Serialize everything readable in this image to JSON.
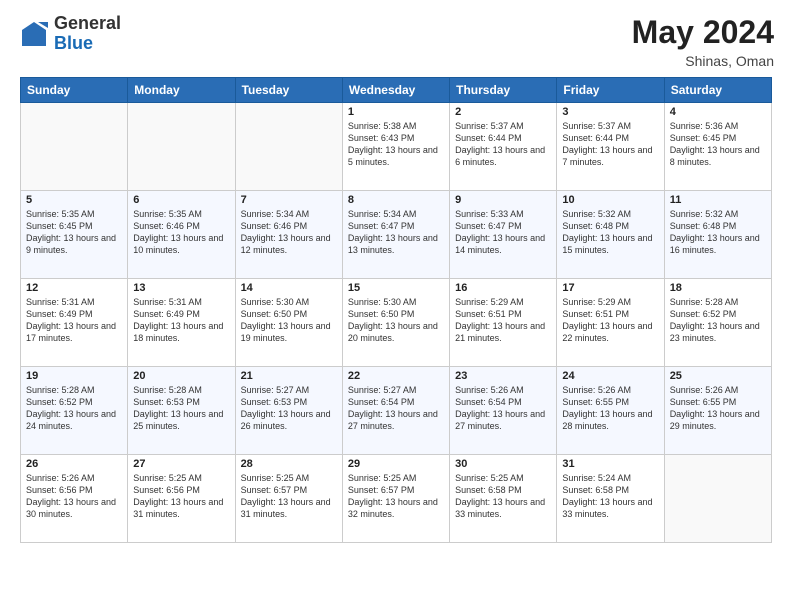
{
  "header": {
    "logo_general": "General",
    "logo_blue": "Blue",
    "month_year": "May 2024",
    "location": "Shinas, Oman"
  },
  "weekdays": [
    "Sunday",
    "Monday",
    "Tuesday",
    "Wednesday",
    "Thursday",
    "Friday",
    "Saturday"
  ],
  "weeks": [
    [
      {
        "day": "",
        "sunrise": "",
        "sunset": "",
        "daylight": ""
      },
      {
        "day": "",
        "sunrise": "",
        "sunset": "",
        "daylight": ""
      },
      {
        "day": "",
        "sunrise": "",
        "sunset": "",
        "daylight": ""
      },
      {
        "day": "1",
        "sunrise": "Sunrise: 5:38 AM",
        "sunset": "Sunset: 6:43 PM",
        "daylight": "Daylight: 13 hours and 5 minutes."
      },
      {
        "day": "2",
        "sunrise": "Sunrise: 5:37 AM",
        "sunset": "Sunset: 6:44 PM",
        "daylight": "Daylight: 13 hours and 6 minutes."
      },
      {
        "day": "3",
        "sunrise": "Sunrise: 5:37 AM",
        "sunset": "Sunset: 6:44 PM",
        "daylight": "Daylight: 13 hours and 7 minutes."
      },
      {
        "day": "4",
        "sunrise": "Sunrise: 5:36 AM",
        "sunset": "Sunset: 6:45 PM",
        "daylight": "Daylight: 13 hours and 8 minutes."
      }
    ],
    [
      {
        "day": "5",
        "sunrise": "Sunrise: 5:35 AM",
        "sunset": "Sunset: 6:45 PM",
        "daylight": "Daylight: 13 hours and 9 minutes."
      },
      {
        "day": "6",
        "sunrise": "Sunrise: 5:35 AM",
        "sunset": "Sunset: 6:46 PM",
        "daylight": "Daylight: 13 hours and 10 minutes."
      },
      {
        "day": "7",
        "sunrise": "Sunrise: 5:34 AM",
        "sunset": "Sunset: 6:46 PM",
        "daylight": "Daylight: 13 hours and 12 minutes."
      },
      {
        "day": "8",
        "sunrise": "Sunrise: 5:34 AM",
        "sunset": "Sunset: 6:47 PM",
        "daylight": "Daylight: 13 hours and 13 minutes."
      },
      {
        "day": "9",
        "sunrise": "Sunrise: 5:33 AM",
        "sunset": "Sunset: 6:47 PM",
        "daylight": "Daylight: 13 hours and 14 minutes."
      },
      {
        "day": "10",
        "sunrise": "Sunrise: 5:32 AM",
        "sunset": "Sunset: 6:48 PM",
        "daylight": "Daylight: 13 hours and 15 minutes."
      },
      {
        "day": "11",
        "sunrise": "Sunrise: 5:32 AM",
        "sunset": "Sunset: 6:48 PM",
        "daylight": "Daylight: 13 hours and 16 minutes."
      }
    ],
    [
      {
        "day": "12",
        "sunrise": "Sunrise: 5:31 AM",
        "sunset": "Sunset: 6:49 PM",
        "daylight": "Daylight: 13 hours and 17 minutes."
      },
      {
        "day": "13",
        "sunrise": "Sunrise: 5:31 AM",
        "sunset": "Sunset: 6:49 PM",
        "daylight": "Daylight: 13 hours and 18 minutes."
      },
      {
        "day": "14",
        "sunrise": "Sunrise: 5:30 AM",
        "sunset": "Sunset: 6:50 PM",
        "daylight": "Daylight: 13 hours and 19 minutes."
      },
      {
        "day": "15",
        "sunrise": "Sunrise: 5:30 AM",
        "sunset": "Sunset: 6:50 PM",
        "daylight": "Daylight: 13 hours and 20 minutes."
      },
      {
        "day": "16",
        "sunrise": "Sunrise: 5:29 AM",
        "sunset": "Sunset: 6:51 PM",
        "daylight": "Daylight: 13 hours and 21 minutes."
      },
      {
        "day": "17",
        "sunrise": "Sunrise: 5:29 AM",
        "sunset": "Sunset: 6:51 PM",
        "daylight": "Daylight: 13 hours and 22 minutes."
      },
      {
        "day": "18",
        "sunrise": "Sunrise: 5:28 AM",
        "sunset": "Sunset: 6:52 PM",
        "daylight": "Daylight: 13 hours and 23 minutes."
      }
    ],
    [
      {
        "day": "19",
        "sunrise": "Sunrise: 5:28 AM",
        "sunset": "Sunset: 6:52 PM",
        "daylight": "Daylight: 13 hours and 24 minutes."
      },
      {
        "day": "20",
        "sunrise": "Sunrise: 5:28 AM",
        "sunset": "Sunset: 6:53 PM",
        "daylight": "Daylight: 13 hours and 25 minutes."
      },
      {
        "day": "21",
        "sunrise": "Sunrise: 5:27 AM",
        "sunset": "Sunset: 6:53 PM",
        "daylight": "Daylight: 13 hours and 26 minutes."
      },
      {
        "day": "22",
        "sunrise": "Sunrise: 5:27 AM",
        "sunset": "Sunset: 6:54 PM",
        "daylight": "Daylight: 13 hours and 27 minutes."
      },
      {
        "day": "23",
        "sunrise": "Sunrise: 5:26 AM",
        "sunset": "Sunset: 6:54 PM",
        "daylight": "Daylight: 13 hours and 27 minutes."
      },
      {
        "day": "24",
        "sunrise": "Sunrise: 5:26 AM",
        "sunset": "Sunset: 6:55 PM",
        "daylight": "Daylight: 13 hours and 28 minutes."
      },
      {
        "day": "25",
        "sunrise": "Sunrise: 5:26 AM",
        "sunset": "Sunset: 6:55 PM",
        "daylight": "Daylight: 13 hours and 29 minutes."
      }
    ],
    [
      {
        "day": "26",
        "sunrise": "Sunrise: 5:26 AM",
        "sunset": "Sunset: 6:56 PM",
        "daylight": "Daylight: 13 hours and 30 minutes."
      },
      {
        "day": "27",
        "sunrise": "Sunrise: 5:25 AM",
        "sunset": "Sunset: 6:56 PM",
        "daylight": "Daylight: 13 hours and 31 minutes."
      },
      {
        "day": "28",
        "sunrise": "Sunrise: 5:25 AM",
        "sunset": "Sunset: 6:57 PM",
        "daylight": "Daylight: 13 hours and 31 minutes."
      },
      {
        "day": "29",
        "sunrise": "Sunrise: 5:25 AM",
        "sunset": "Sunset: 6:57 PM",
        "daylight": "Daylight: 13 hours and 32 minutes."
      },
      {
        "day": "30",
        "sunrise": "Sunrise: 5:25 AM",
        "sunset": "Sunset: 6:58 PM",
        "daylight": "Daylight: 13 hours and 33 minutes."
      },
      {
        "day": "31",
        "sunrise": "Sunrise: 5:24 AM",
        "sunset": "Sunset: 6:58 PM",
        "daylight": "Daylight: 13 hours and 33 minutes."
      },
      {
        "day": "",
        "sunrise": "",
        "sunset": "",
        "daylight": ""
      }
    ]
  ]
}
